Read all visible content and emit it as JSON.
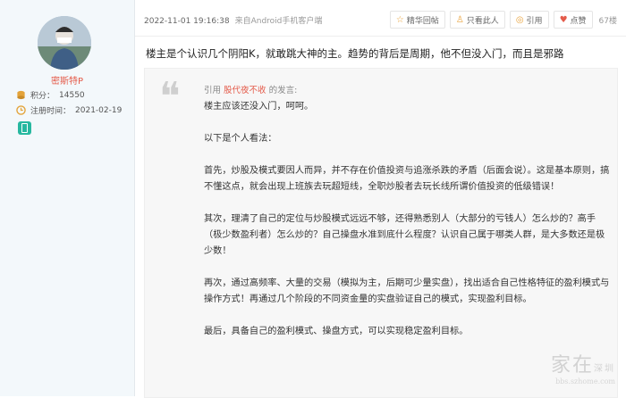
{
  "user": {
    "name": "密斯特P",
    "points_label": "积分：",
    "points": "14550",
    "reg_label": "注册时间：",
    "reg_date": "2021-02-19"
  },
  "post": {
    "timestamp": "2022-11-01 19:16:38",
    "source": "来自Android手机客户端",
    "actions": {
      "back": "精华回帖",
      "only_author": "只看此人",
      "quote": "引用",
      "like": "点赞"
    },
    "floor": "67楼",
    "lead": "楼主是个认识几个阴阳K，就敢跳大神的主。趋势的背后是周期，他不但没入门，而且是邪路",
    "quote": {
      "prefix": "引用",
      "user": "股代夜不收",
      "suffix": "的发言:",
      "paragraphs": [
        "楼主应该还没入门，呵呵。",
        "以下是个人看法：",
        "首先，炒股及模式要因人而异，并不存在价值投资与追涨杀跌的矛盾（后面会说）。这是基本原则，搞不懂这点，就会出现上班族去玩超短线，全职炒股者去玩长线所谓价值投资的低级错误！",
        "其次，理清了自己的定位与炒股模式远远不够，还得熟悉别人（大部分的亏钱人）怎么炒的？高手（极少数盈利者）怎么炒的？自己操盘水准到底什么程度？认识自己属于哪类人群，是大多数还是极少数！",
        "再次，通过高频率、大量的交易（模拟为主，后期可少量实盘），找出适合自己性格特征的盈利模式与操作方式！再通过几个阶段的不同资金量的实盘验证自己的模式，实现盈利目标。",
        "最后，具备自己的盈利模式、操盘方式，可以实现稳定盈利目标。"
      ]
    }
  },
  "watermark": {
    "main": "家在",
    "tag": "深圳",
    "url": "bbs.szhome.com"
  },
  "icons": {
    "points": "coin-stack-icon",
    "reg": "clock-icon",
    "mobile": "mobile-phone-icon"
  }
}
